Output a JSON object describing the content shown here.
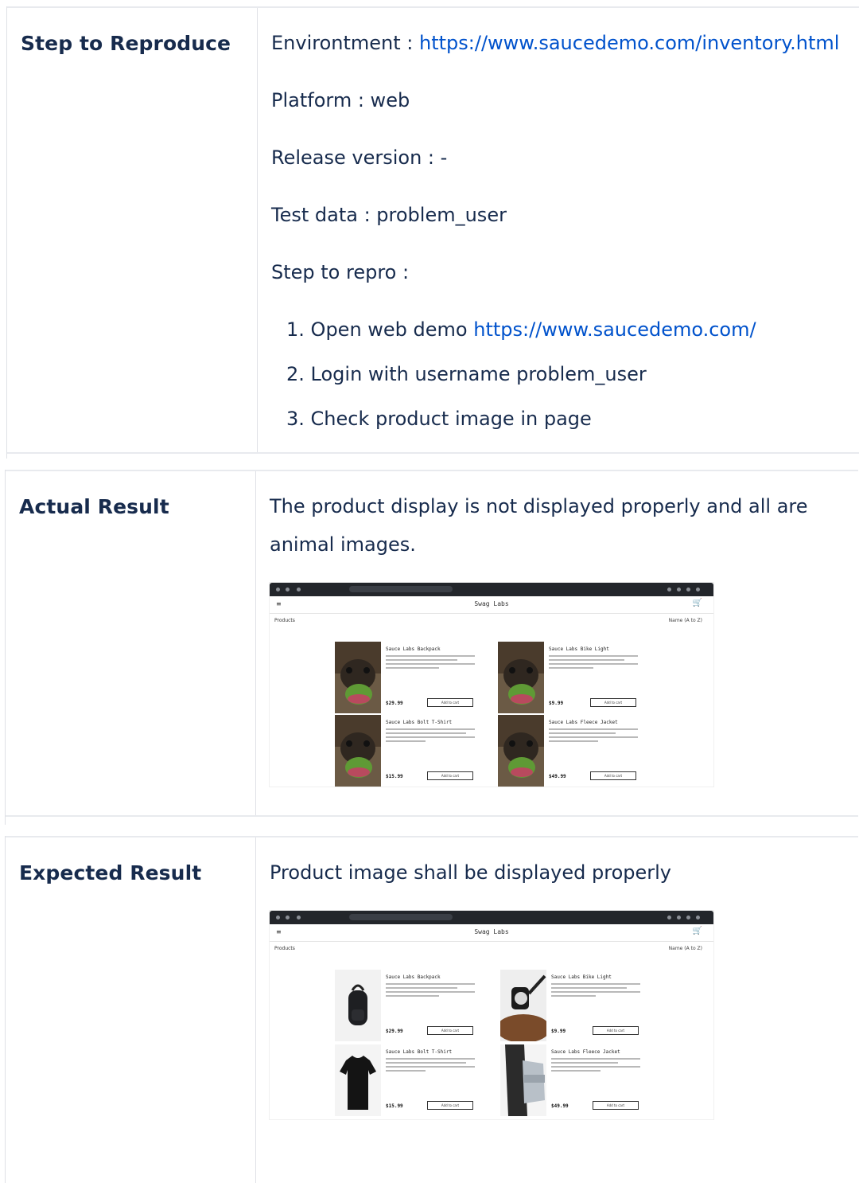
{
  "rows": [
    {
      "header": "Step to Reproduce",
      "lines": [
        {
          "label": "Environtment : ",
          "link": "https://www.saucedemo.com/inventory.html"
        },
        {
          "label": "Platform : web"
        },
        {
          "label": "Release version : -"
        },
        {
          "label": "Test data : problem_user"
        },
        {
          "label": "Step to repro :"
        }
      ],
      "steps": [
        {
          "num": "1.",
          "text": "Open web demo ",
          "link": "https://www.saucedemo.com/"
        },
        {
          "num": "2.",
          "text": "Login with username problem_user"
        },
        {
          "num": "3.",
          "text": "Check product image in page"
        }
      ]
    },
    {
      "header": "Actual Result",
      "lines": [
        {
          "label": "The product display is not displayed properly and all are"
        },
        {
          "label": "animal images."
        }
      ]
    },
    {
      "header": "Expected Result",
      "lines": [
        {
          "label": "Product image shall be displayed properly"
        }
      ]
    }
  ],
  "screenshot": {
    "brand": "Swag Labs",
    "section": "Products",
    "sort": "Name (A to Z)",
    "add_label": "Add to cart",
    "products": [
      {
        "name": "Sauce Labs Backpack",
        "price": "$29.99",
        "icon": "backpack-icon"
      },
      {
        "name": "Sauce Labs Bike Light",
        "price": "$9.99",
        "icon": "bike-light-icon"
      },
      {
        "name": "Sauce Labs Bolt T-Shirt",
        "price": "$15.99",
        "icon": "tshirt-icon"
      },
      {
        "name": "Sauce Labs Fleece Jacket",
        "price": "$49.99",
        "icon": "jacket-icon"
      }
    ]
  },
  "colors": {
    "link": "#0052cc",
    "text": "#172b4d",
    "border": "#dfe1e6",
    "header_bar": "#23262b"
  }
}
